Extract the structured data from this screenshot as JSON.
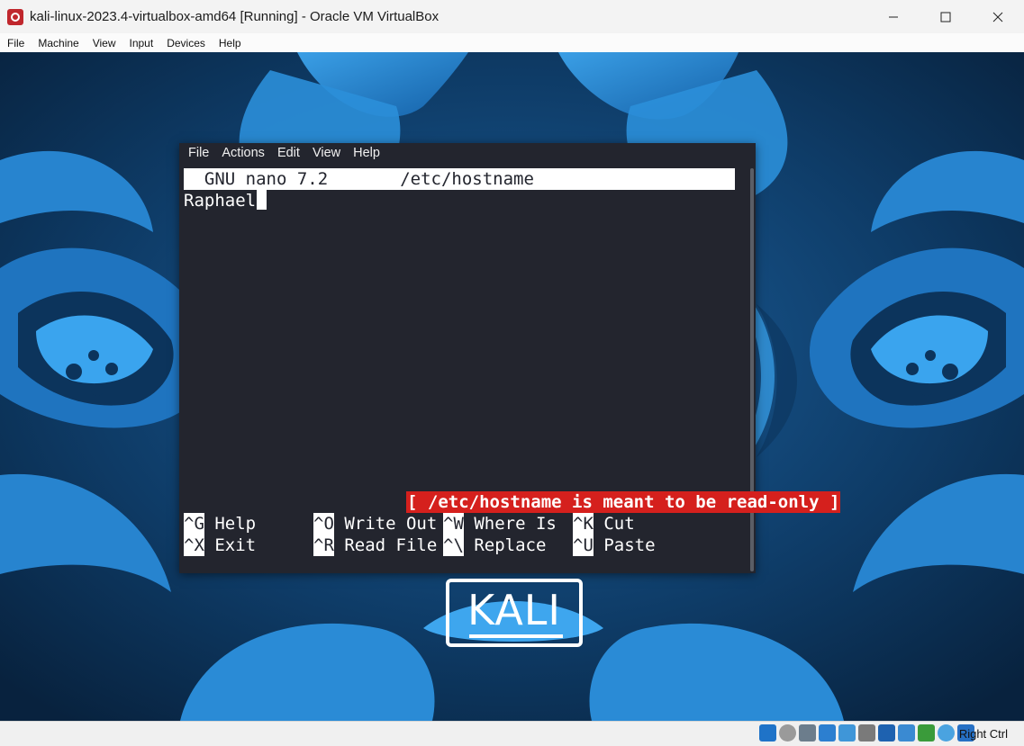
{
  "window": {
    "title": "kali-linux-2023.4-virtualbox-amd64 [Running] - Oracle VM VirtualBox",
    "minimize_glyph": "—",
    "maximize_glyph": "□",
    "close_glyph": "✕"
  },
  "host_menu": [
    "File",
    "Machine",
    "View",
    "Input",
    "Devices",
    "Help"
  ],
  "terminal": {
    "menu": [
      "File",
      "Actions",
      "Edit",
      "View",
      "Help"
    ],
    "nano": {
      "header": "  GNU nano 7.2       /etc/hostname",
      "content": "Raphael",
      "status": "[ /etc/hostname is meant to be read-only ]",
      "shortcuts_row1": [
        {
          "key": "^G",
          "label": " Help"
        },
        {
          "key": "^O",
          "label": " Write Out"
        },
        {
          "key": "^W",
          "label": " Where Is"
        },
        {
          "key": "^K",
          "label": " Cut"
        }
      ],
      "shortcuts_row2": [
        {
          "key": "^X",
          "label": " Exit"
        },
        {
          "key": "^R",
          "label": " Read File"
        },
        {
          "key": "^\\",
          "label": " Replace"
        },
        {
          "key": "^U",
          "label": " Paste"
        }
      ]
    }
  },
  "desktop": {
    "logo_text": "KALI"
  },
  "statusbar": {
    "host_key": "Right Ctrl",
    "icons": [
      "hard-disk-icon",
      "optical-drive-icon",
      "audio-icon",
      "network-icon",
      "usb-icon",
      "shared-folder-icon",
      "display-icon",
      "recording-icon",
      "cpu-icon",
      "mouse-integration-icon",
      "keyboard-icon"
    ]
  },
  "colors": {
    "terminal_bg": "#23252e",
    "status_red": "#d5201d",
    "wallpaper_dark": "#0a2b4c",
    "wallpaper_light": "#2a86d1"
  }
}
